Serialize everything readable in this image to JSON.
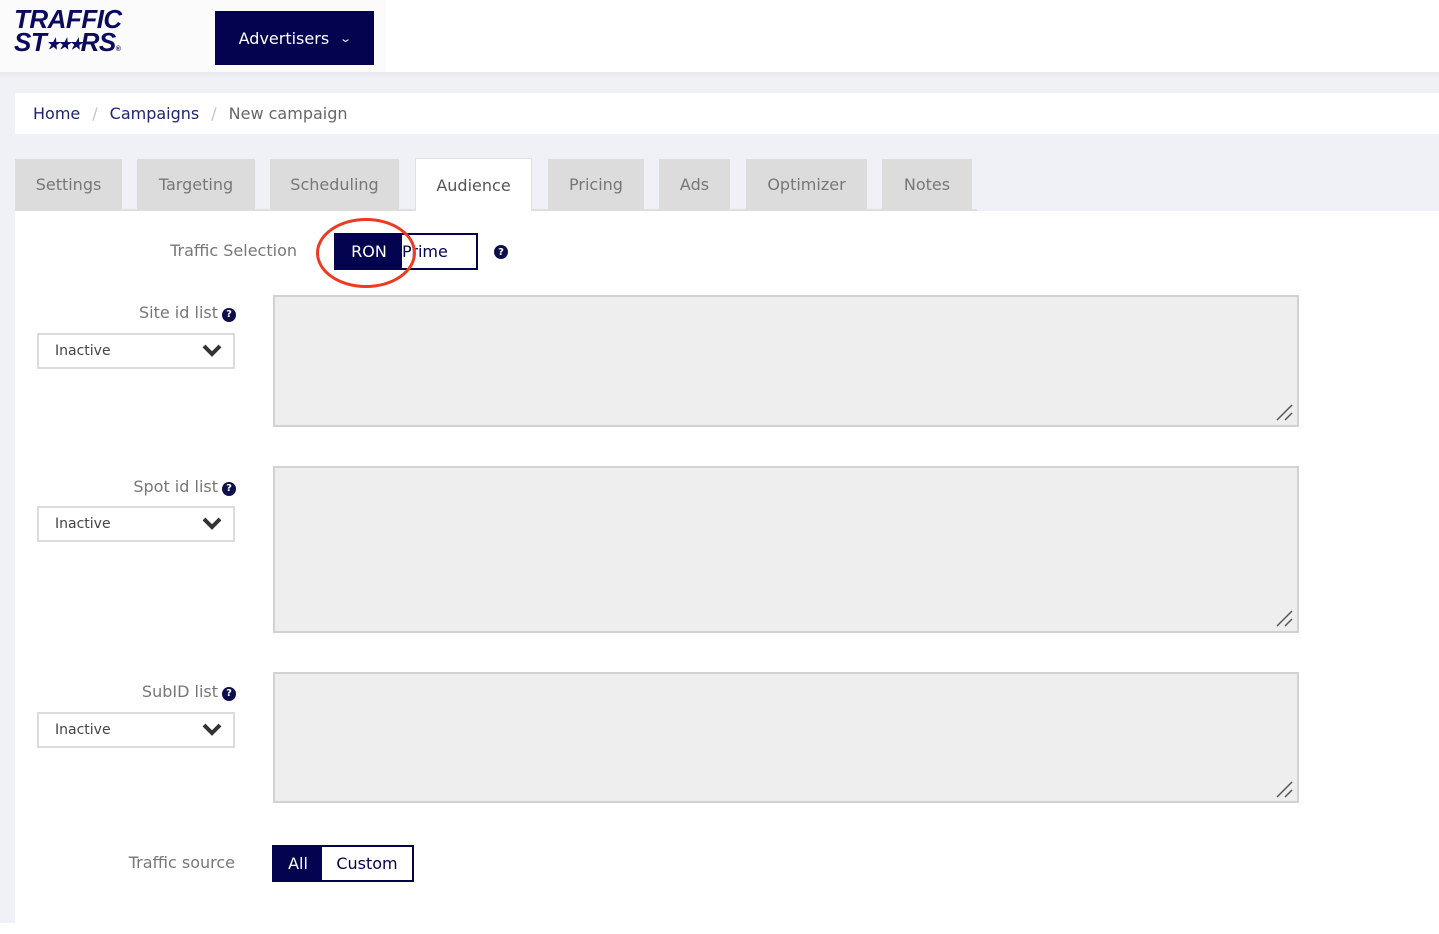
{
  "header": {
    "logo_line1": "TRAFFIC",
    "logo_line2_left": "ST",
    "logo_line2_right": "RS",
    "logo_reg": "®",
    "role_menu_label": "Advertisers",
    "role_menu_icon": "chevron-down-icon"
  },
  "breadcrumb": {
    "items": [
      {
        "label": "Home",
        "link": true
      },
      {
        "label": "Campaigns",
        "link": true
      },
      {
        "label": "New campaign",
        "link": false
      }
    ],
    "separator": "/"
  },
  "tabs": [
    {
      "label": "Settings",
      "active": false
    },
    {
      "label": "Targeting",
      "active": false
    },
    {
      "label": "Scheduling",
      "active": false
    },
    {
      "label": "Audience",
      "active": true
    },
    {
      "label": "Pricing",
      "active": false
    },
    {
      "label": "Ads",
      "active": false
    },
    {
      "label": "Optimizer",
      "active": false
    },
    {
      "label": "Notes",
      "active": false
    }
  ],
  "form": {
    "traffic_selection": {
      "label": "Traffic Selection",
      "options": [
        "RON",
        "Prime"
      ],
      "selected": "RON",
      "help_icon": "question-circle-icon",
      "annotation": "red-circle-highlight-around-RON"
    },
    "lists": [
      {
        "label": "Site id list",
        "help_icon": "question-circle-icon",
        "select_value": "Inactive",
        "textarea_value": ""
      },
      {
        "label": "Spot id list",
        "help_icon": "question-circle-icon",
        "select_value": "Inactive",
        "textarea_value": ""
      },
      {
        "label": "SubID list",
        "help_icon": "question-circle-icon",
        "select_value": "Inactive",
        "textarea_value": ""
      }
    ],
    "traffic_source": {
      "label": "Traffic source",
      "options": [
        "All",
        "Custom"
      ],
      "selected": "All"
    }
  },
  "colors": {
    "brand_navy": "#030350",
    "annotation_red": "#ee3a22",
    "tab_inactive_bg": "#dcdcdc",
    "textarea_bg": "#eeeeee",
    "page_bg": "#f0f1f6"
  }
}
